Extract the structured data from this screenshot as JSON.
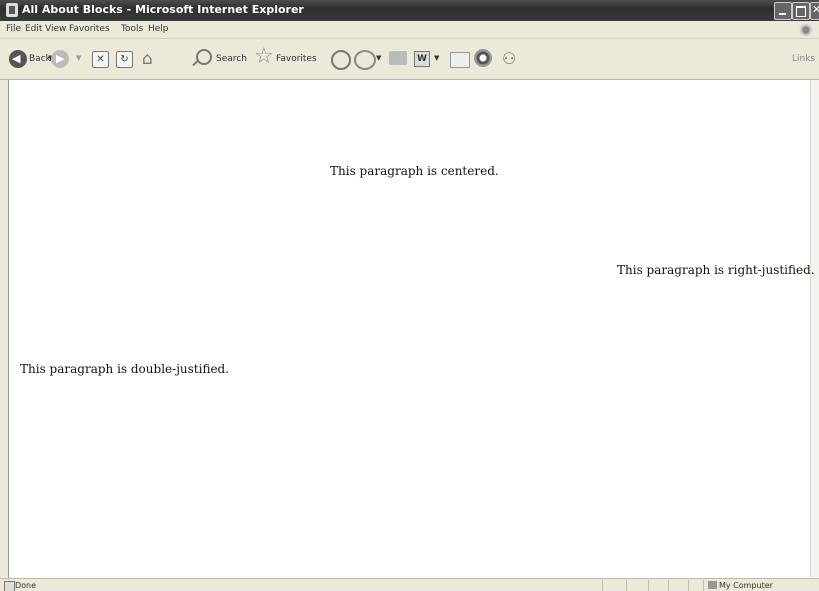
{
  "window": {
    "title": "All About Blocks - Microsoft Internet Explorer"
  },
  "menu": [
    "File",
    "Edit",
    "View",
    "Favorites",
    "Tools",
    "Help"
  ],
  "toolbar": {
    "back_label": "Back",
    "search_label": "Search",
    "favorites_label": "Favorites",
    "links_label": "Links"
  },
  "content": {
    "paragraphs": [
      "This paragraph is centered.",
      "This paragraph is right-justified.",
      "This paragraph is double-justified."
    ]
  },
  "status": {
    "text": "Done",
    "zone": "My Computer"
  }
}
